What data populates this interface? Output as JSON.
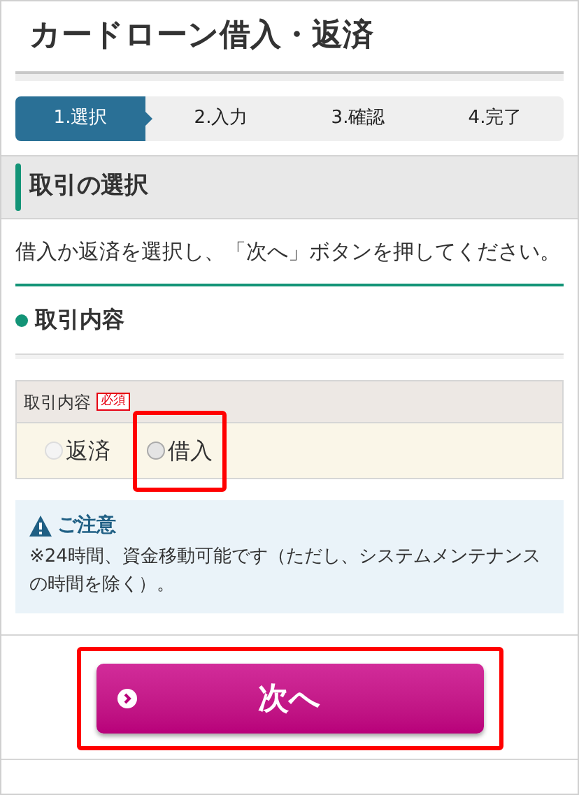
{
  "page": {
    "title": "カードローン借入・返済"
  },
  "steps": [
    {
      "label": "1.選択",
      "selected": true
    },
    {
      "label": "2.入力",
      "selected": false
    },
    {
      "label": "3.確認",
      "selected": false
    },
    {
      "label": "4.完了",
      "selected": false
    }
  ],
  "section": {
    "title": "取引の選択",
    "instruction": "借入か返済を選択し、「次へ」ボタンを押してください。"
  },
  "subsection": {
    "title": "取引内容"
  },
  "form": {
    "label": "取引内容",
    "required_badge": "必須",
    "options": [
      {
        "label": "返済",
        "selected": false,
        "highlighted": false
      },
      {
        "label": "借入",
        "selected": false,
        "highlighted": true
      }
    ]
  },
  "notice": {
    "title": "ご注意",
    "text": "※24時間、資金移動可能です（ただし、システムメンテナンスの時間を除く）。"
  },
  "next_button": {
    "label": "次へ",
    "highlighted": true
  }
}
